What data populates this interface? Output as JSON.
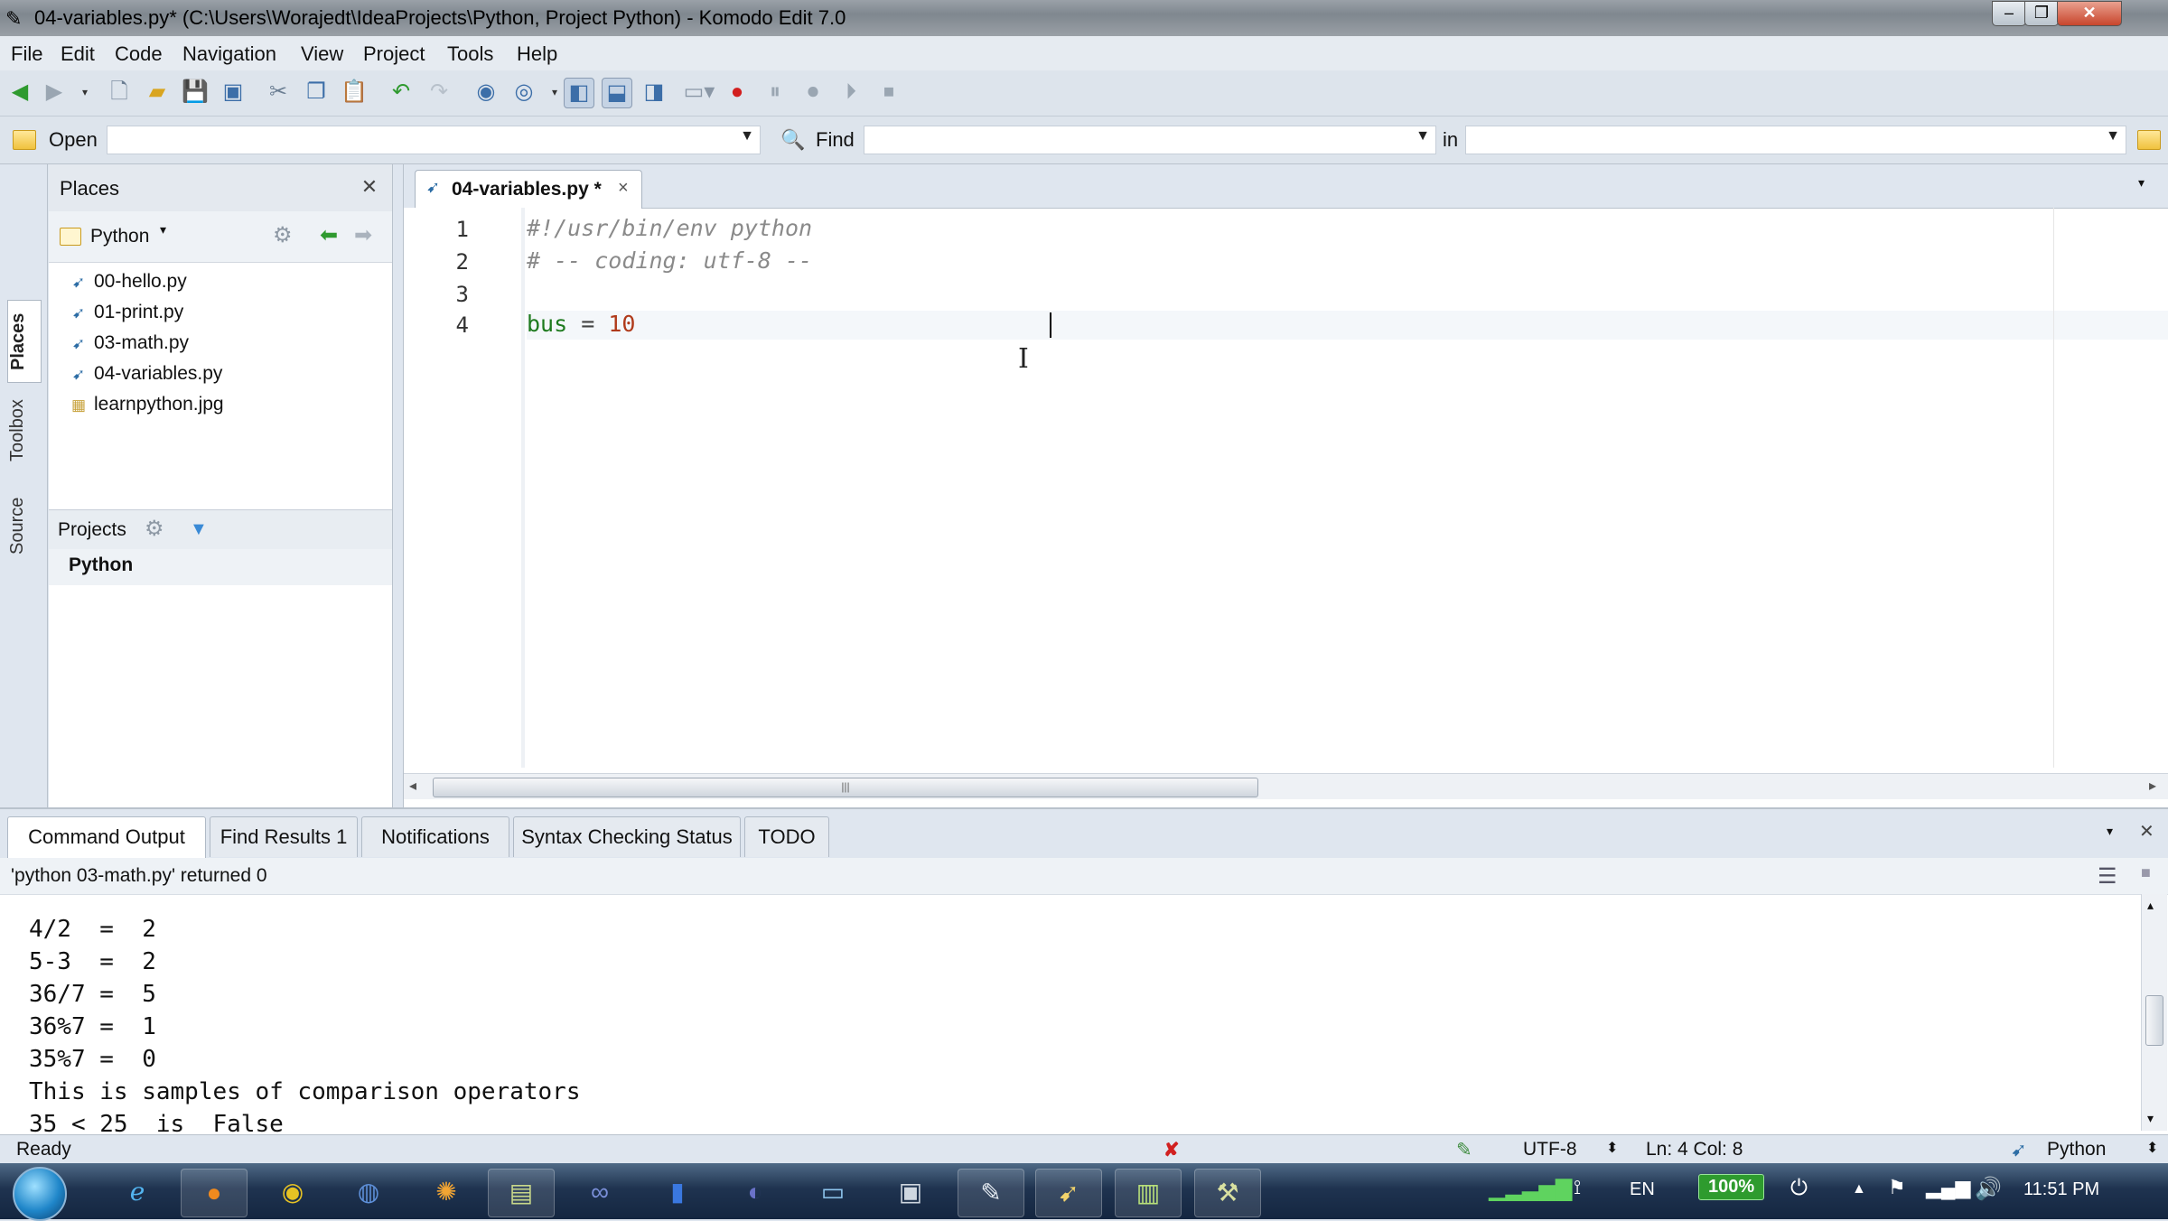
{
  "window": {
    "title": "04-variables.py* (C:\\Users\\Worajedt\\IdeaProjects\\Python, Project Python) - Komodo Edit 7.0"
  },
  "menu": [
    "File",
    "Edit",
    "Code",
    "Navigation",
    "View",
    "Project",
    "Tools",
    "Help"
  ],
  "openbar": {
    "open_label": "Open",
    "find_label": "Find",
    "in_label": "in",
    "open_value": "",
    "find_value": "",
    "in_value": ""
  },
  "left_tabs": [
    "Places",
    "Toolbox",
    "Source"
  ],
  "places": {
    "title": "Places",
    "root": "Python",
    "files": [
      {
        "name": "00-hello.py",
        "icon": "python-file-icon"
      },
      {
        "name": "01-print.py",
        "icon": "python-file-icon"
      },
      {
        "name": "03-math.py",
        "icon": "python-file-icon"
      },
      {
        "name": "04-variables.py",
        "icon": "python-file-icon"
      },
      {
        "name": "learnpython.jpg",
        "icon": "image-file-icon"
      }
    ],
    "projects_title": "Projects",
    "project": "Python"
  },
  "editor": {
    "tab_label": "04-variables.py *",
    "line_numbers": [
      "1",
      "2",
      "3",
      "4"
    ],
    "lines": {
      "l1": "#!/usr/bin/env python",
      "l2": "# -- coding: utf-8 --",
      "l4_ident": "bus",
      "l4_op": " = ",
      "l4_num": "10"
    }
  },
  "bottom": {
    "tabs": [
      "Command Output",
      "Find Results 1",
      "Notifications",
      "Syntax Checking Status",
      "TODO"
    ],
    "status_line": "'python 03-math.py' returned 0",
    "output": [
      "4/2  =  2",
      "5-3  =  2",
      "36/7 =  5",
      "36%7 =  1",
      "35%7 =  0",
      "This is samples of comparison operators",
      "35 < 25  is  False"
    ]
  },
  "statusbar": {
    "ready": "Ready",
    "encoding": "UTF-8",
    "position": "Ln: 4 Col: 8",
    "language": "Python"
  },
  "taskbar": {
    "language": "EN",
    "battery": "100%",
    "clock": "11:51 PM"
  },
  "colors": {
    "accent": "#3c6ea8",
    "comment": "#8a8a8a",
    "identifier": "#1e7a1e",
    "number": "#b03a1a"
  }
}
